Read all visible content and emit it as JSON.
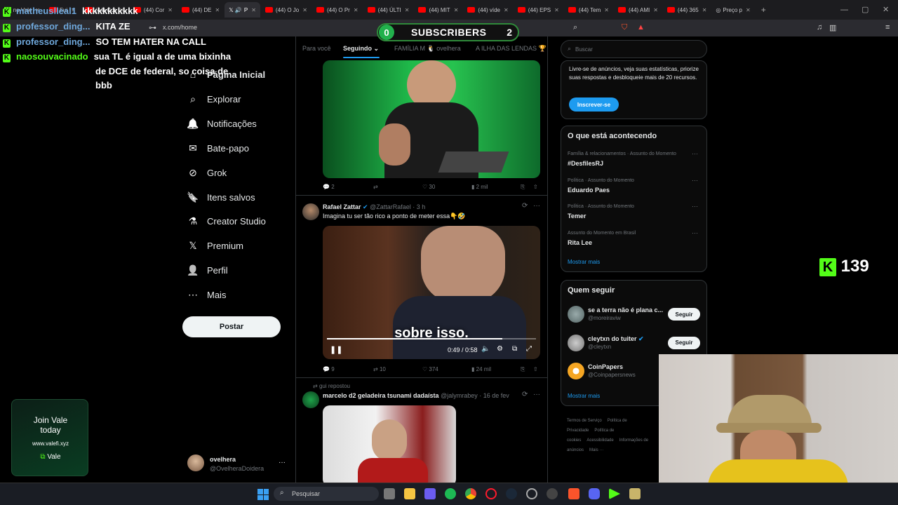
{
  "browser": {
    "tabs": [
      {
        "label": "no Vale",
        "kind": "kick"
      },
      {
        "label": "Fui",
        "kind": "yt"
      },
      {
        "label": "(44) Cor",
        "kind": "yt"
      },
      {
        "label": "(44) Cor",
        "kind": "yt"
      },
      {
        "label": "(44) DE",
        "kind": "yt"
      },
      {
        "label": "P",
        "kind": "x",
        "active": true
      },
      {
        "label": "(44) O Jo",
        "kind": "yt"
      },
      {
        "label": "(44) O Pr",
        "kind": "yt"
      },
      {
        "label": "(44) ÚLTI",
        "kind": "yt"
      },
      {
        "label": "(44) MIT",
        "kind": "yt"
      },
      {
        "label": "(44) víde",
        "kind": "yt"
      },
      {
        "label": "(44) EPS",
        "kind": "yt"
      },
      {
        "label": "(44) Tem",
        "kind": "yt"
      },
      {
        "label": "(44) AMI",
        "kind": "yt"
      },
      {
        "label": "(44) 365",
        "kind": "yt"
      },
      {
        "label": "Preço p",
        "kind": "web"
      }
    ],
    "url": "x.com/home"
  },
  "overlay": {
    "subscribers_count": "0",
    "subscribers_label": "SUBSCRIBERS",
    "subscribers_goal": "2",
    "kick_viewers": "139",
    "join_title": "Join Vale",
    "join_sub": "today",
    "join_url": "www.valefi.xyz",
    "join_brand": "Vale"
  },
  "chat": [
    {
      "user": "matheuslleal1",
      "msg": "kkkkkkkkkkk"
    },
    {
      "user": "professor_ding...",
      "msg": "KITA ZE"
    },
    {
      "user": "professor_ding...",
      "msg": "SO TEM HATER NA CALL"
    },
    {
      "user": "naosouvacinado",
      "msg": "sua TL é igual a de uma bixinha"
    },
    {
      "user": "",
      "msg": "de DCE de federal, so coisa de"
    },
    {
      "user": "",
      "msg": "bbb"
    }
  ],
  "nav": {
    "items": [
      {
        "label": "Página Inicial",
        "icon": "home-icon"
      },
      {
        "label": "Explorar",
        "icon": "search-icon"
      },
      {
        "label": "Notificações",
        "icon": "bell-icon"
      },
      {
        "label": "Bate-papo",
        "icon": "mail-icon"
      },
      {
        "label": "Grok",
        "icon": "grok-icon"
      },
      {
        "label": "Itens salvos",
        "icon": "bookmark-icon"
      },
      {
        "label": "Creator Studio",
        "icon": "flask-icon"
      },
      {
        "label": "Premium",
        "icon": "x-logo-icon"
      },
      {
        "label": "Perfil",
        "icon": "person-icon"
      },
      {
        "label": "Mais",
        "icon": "more-icon"
      }
    ],
    "post_label": "Postar",
    "account_name": "ovelhera",
    "account_handle": "@OvelheraDoidera"
  },
  "feed": {
    "tabs": [
      "Para você",
      "Seguindo",
      "FAMÍLIA M 🐧 ovelhera",
      "A ILHA DAS LENDAS 🏆"
    ],
    "posts": [
      {
        "name": "",
        "handle": "",
        "time": "",
        "text": "",
        "replies": "2",
        "reposts": "",
        "likes": "30",
        "views": "2 mil"
      },
      {
        "name": "Rafael Zattar",
        "handle": "@ZattarRafael",
        "time": "· 3 h",
        "text": "Imagina tu ser tão rico a ponto de meter essa👇🤣",
        "video_caption": "sobre isso.",
        "video_time": "0:49 / 0:58",
        "video_progress": 0.84,
        "replies": "9",
        "reposts": "10",
        "likes": "374",
        "views": "24 mil"
      },
      {
        "repost_by": "gui repostou",
        "name": "marcelo d2 geladeira tsunami dadaísta",
        "handle": "@jalymrabey",
        "time": "· 16 de fev"
      }
    ]
  },
  "right": {
    "search_placeholder": "Buscar",
    "premium_text": "Livre-se de anúncios, veja suas estatísticas, priorize suas respostas e desbloqueie mais de 20 recursos.",
    "premium_btn": "Inscrever-se",
    "trends_title": "O que está acontecendo",
    "trends": [
      {
        "cat": "Família & relacionamentos · Assunto do Momento",
        "title": "#DesfilesRJ"
      },
      {
        "cat": "Política · Assunto do Momento",
        "title": "Eduardo Paes"
      },
      {
        "cat": "Política · Assunto do Momento",
        "title": "Temer"
      },
      {
        "cat": "Assunto do Momento em Brasil",
        "title": "Rita Lee"
      }
    ],
    "show_more": "Mostrar mais",
    "follow_title": "Quem seguir",
    "follow": [
      {
        "name": "se a terra não é plana c...",
        "handle": "@moreiraviw",
        "btn": "Seguir"
      },
      {
        "name": "cleytxn do tuiter",
        "handle": "@cleytxn",
        "btn": "Seguir"
      },
      {
        "name": "CoinPapers",
        "handle": "@Coinpapersnews",
        "btn": ""
      }
    ],
    "footer": [
      "Termos de Serviço",
      "Política de Privacidade",
      "Política de cookies",
      "Acessibilidade",
      "Informações de anúncios",
      "Mais ···"
    ]
  },
  "taskbar": {
    "search_placeholder": "Pesquisar"
  },
  "colors": {
    "kick_green": "#53fc18",
    "x_blue": "#1d9bf0",
    "yt_red": "#ff0000"
  }
}
